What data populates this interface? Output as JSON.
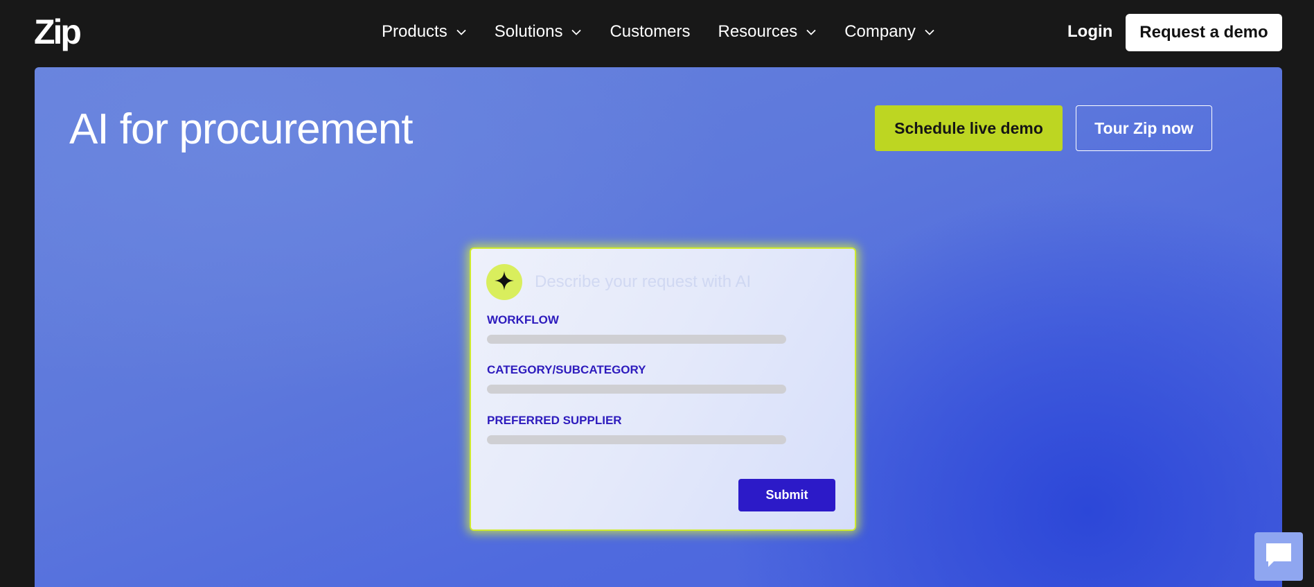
{
  "header": {
    "logo_text": "Zip",
    "nav": [
      {
        "label": "Products",
        "has_dropdown": true
      },
      {
        "label": "Solutions",
        "has_dropdown": true
      },
      {
        "label": "Customers",
        "has_dropdown": false
      },
      {
        "label": "Resources",
        "has_dropdown": true
      },
      {
        "label": "Company",
        "has_dropdown": true
      }
    ],
    "login_label": "Login",
    "request_demo_label": "Request a demo"
  },
  "hero": {
    "title": "AI for procurement",
    "schedule_demo_label": "Schedule live demo",
    "tour_label": "Tour Zip now"
  },
  "card": {
    "badge_icon": "sparkle-icon",
    "hint_text": "Describe your request with AI",
    "fields": [
      {
        "label": "WORKFLOW"
      },
      {
        "label": "CATEGORY/SUBCATEGORY"
      },
      {
        "label": "PREFERRED SUPPLIER"
      }
    ],
    "submit_label": "Submit"
  },
  "chat_widget": {
    "icon": "chat-bubble-icon"
  },
  "colors": {
    "page_bg": "#181818",
    "hero_blue": "#5d78dc",
    "accent_lime": "#bdd622",
    "submit_purple": "#2c1ac8",
    "label_purple": "#2d1bbd"
  }
}
